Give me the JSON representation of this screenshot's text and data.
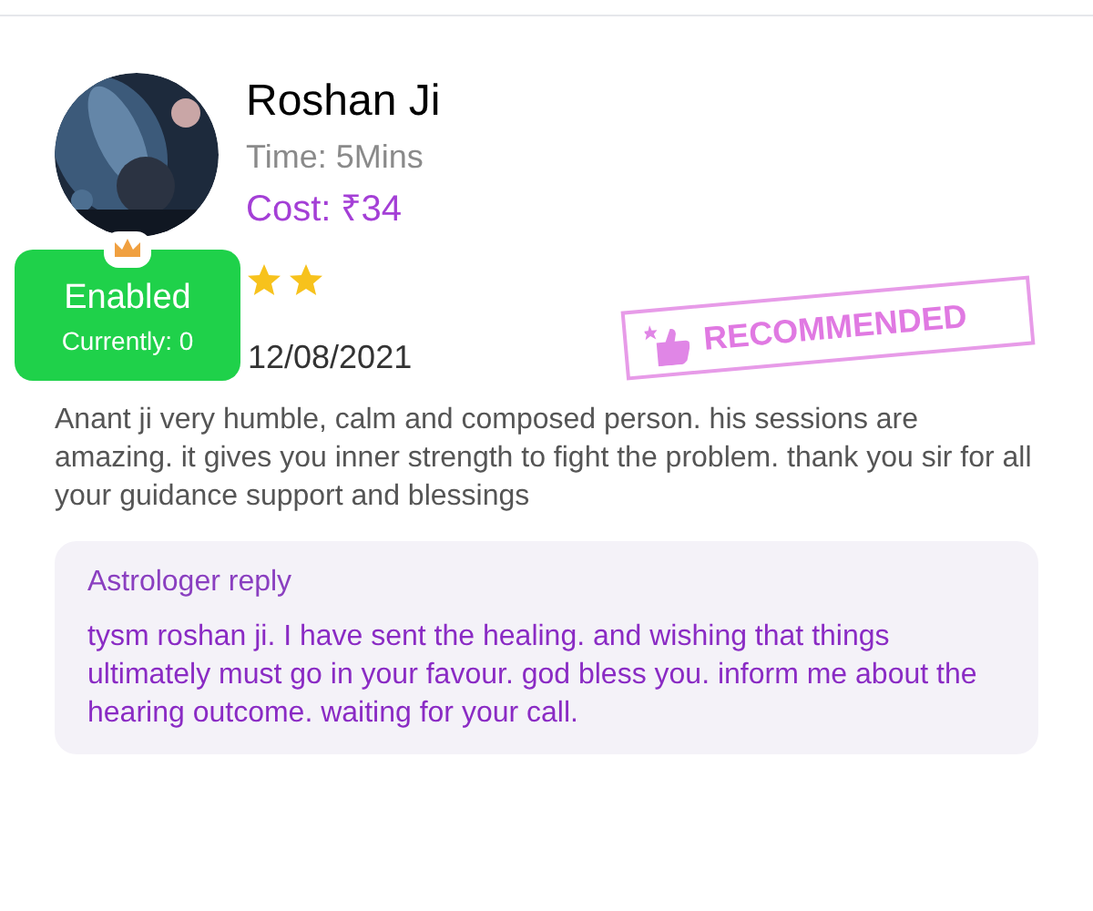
{
  "review": {
    "name": "Roshan Ji",
    "time": "Time: 5Mins",
    "cost": "Cost: ₹34",
    "date": "12/08/2021",
    "badge": {
      "status": "Enabled",
      "count": "Currently: 0"
    },
    "stamp": "RECOMMENDED",
    "text": "Anant ji very humble, calm and composed person. his sessions are amazing. it gives you inner strength to fight the problem. thank you sir for all your guidance support and blessings",
    "reply": {
      "heading": "Astrologer reply",
      "text": "tysm roshan ji. I have sent the healing. and wishing that things ultimately must go in your favour. god bless you. inform me about the hearing outcome. waiting for your call."
    }
  }
}
